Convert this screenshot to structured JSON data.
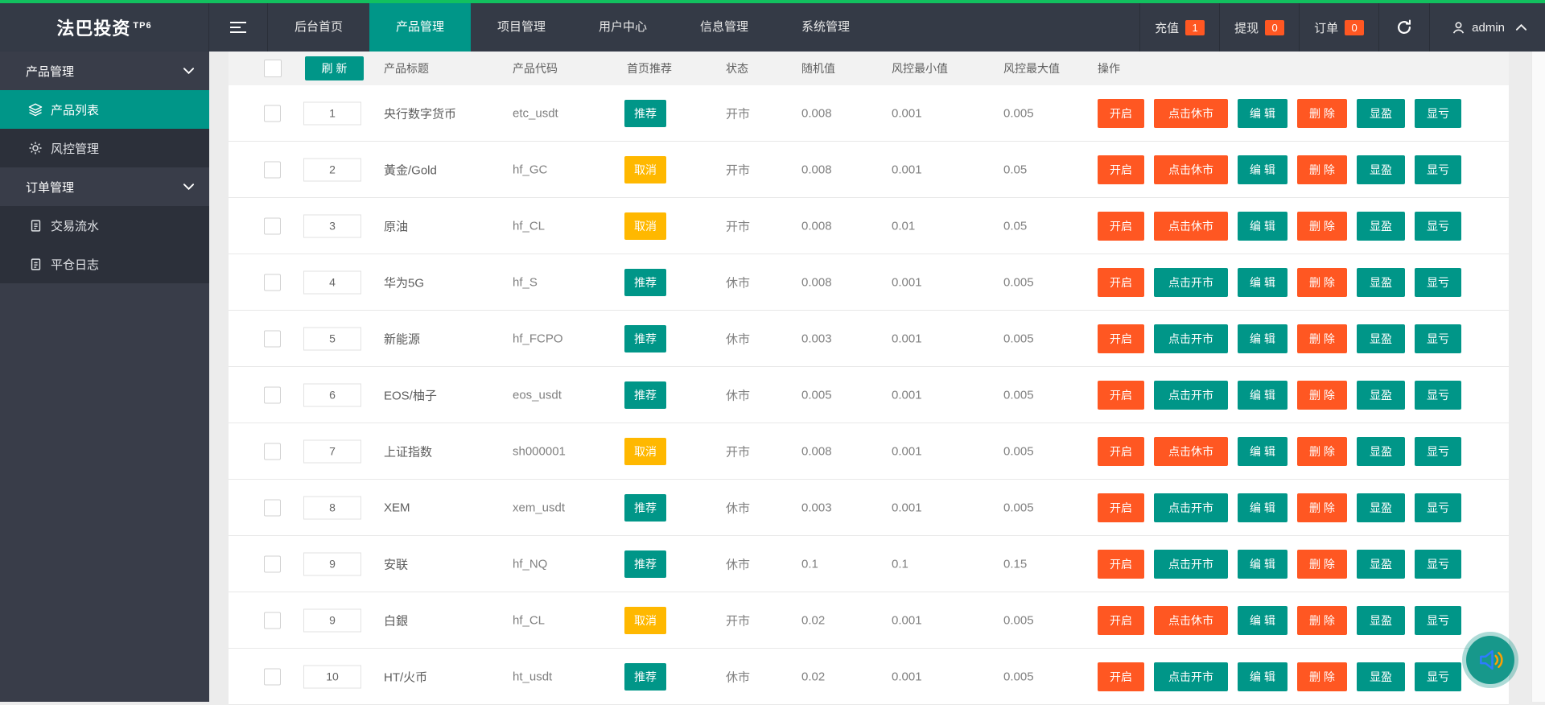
{
  "topbar": {
    "logo": "法巴投资",
    "logo_sup": "TP6",
    "nav": [
      {
        "label": "后台首页",
        "active": false
      },
      {
        "label": "产品管理",
        "active": true
      },
      {
        "label": "项目管理",
        "active": false
      },
      {
        "label": "用户中心",
        "active": false
      },
      {
        "label": "信息管理",
        "active": false
      },
      {
        "label": "系统管理",
        "active": false
      }
    ],
    "stats": [
      {
        "label": "充值",
        "count": "1"
      },
      {
        "label": "提现",
        "count": "0"
      },
      {
        "label": "订单",
        "count": "0"
      }
    ],
    "username": "admin"
  },
  "sidebar": {
    "groups": [
      {
        "label": "产品管理",
        "items": [
          {
            "label": "产品列表",
            "icon": "layers-icon",
            "active": true
          },
          {
            "label": "风控管理",
            "icon": "gear-icon",
            "active": false
          }
        ]
      },
      {
        "label": "订单管理",
        "items": [
          {
            "label": "交易流水",
            "icon": "document-icon",
            "active": false
          },
          {
            "label": "平仓日志",
            "icon": "document-icon",
            "active": false
          }
        ]
      }
    ]
  },
  "table": {
    "refresh_label": "刷 新",
    "headers": {
      "title": "产品标题",
      "code": "产品代码",
      "recommend": "首页推荐",
      "status": "状态",
      "random": "随机值",
      "risk_min": "风控最小值",
      "risk_max": "风控最大值",
      "actions": "操作"
    },
    "action_labels": {
      "open": "开启",
      "close_market": "点击休市",
      "open_market": "点击开市",
      "edit": "编 辑",
      "delete": "删 除",
      "show_win": "显盈",
      "show_loss": "显亏"
    },
    "recommend_labels": {
      "on": "推荐",
      "off": "取消"
    },
    "rows": [
      {
        "sort": "1",
        "title": "央行数字货币",
        "code": "etc_usdt",
        "recommend": "on",
        "status": "开市",
        "random": "0.008",
        "risk_min": "0.001",
        "risk_max": "0.005",
        "market": "open"
      },
      {
        "sort": "2",
        "title": "黃金/Gold",
        "code": "hf_GC",
        "recommend": "off",
        "status": "开市",
        "random": "0.008",
        "risk_min": "0.001",
        "risk_max": "0.05",
        "market": "open"
      },
      {
        "sort": "3",
        "title": "原油",
        "code": "hf_CL",
        "recommend": "off",
        "status": "开市",
        "random": "0.008",
        "risk_min": "0.01",
        "risk_max": "0.05",
        "market": "open"
      },
      {
        "sort": "4",
        "title": "华为5G",
        "code": "hf_S",
        "recommend": "on",
        "status": "休市",
        "random": "0.008",
        "risk_min": "0.001",
        "risk_max": "0.005",
        "market": "closed"
      },
      {
        "sort": "5",
        "title": "新能源",
        "code": "hf_FCPO",
        "recommend": "on",
        "status": "休市",
        "random": "0.003",
        "risk_min": "0.001",
        "risk_max": "0.005",
        "market": "closed"
      },
      {
        "sort": "6",
        "title": "EOS/柚子",
        "code": "eos_usdt",
        "recommend": "on",
        "status": "休市",
        "random": "0.005",
        "risk_min": "0.001",
        "risk_max": "0.005",
        "market": "closed"
      },
      {
        "sort": "7",
        "title": "上证指数",
        "code": "sh000001",
        "recommend": "off",
        "status": "开市",
        "random": "0.008",
        "risk_min": "0.001",
        "risk_max": "0.005",
        "market": "open"
      },
      {
        "sort": "8",
        "title": "XEM",
        "code": "xem_usdt",
        "recommend": "on",
        "status": "休市",
        "random": "0.003",
        "risk_min": "0.001",
        "risk_max": "0.005",
        "market": "closed"
      },
      {
        "sort": "9",
        "title": "安联",
        "code": "hf_NQ",
        "recommend": "on",
        "status": "休市",
        "random": "0.1",
        "risk_min": "0.1",
        "risk_max": "0.15",
        "market": "closed"
      },
      {
        "sort": "9",
        "title": "白銀",
        "code": "hf_CL",
        "recommend": "off",
        "status": "开市",
        "random": "0.02",
        "risk_min": "0.001",
        "risk_max": "0.005",
        "market": "open"
      },
      {
        "sort": "10",
        "title": "HT/火币",
        "code": "ht_usdt",
        "recommend": "on",
        "status": "休市",
        "random": "0.02",
        "risk_min": "0.001",
        "risk_max": "0.005",
        "market": "closed"
      }
    ]
  },
  "colors": {
    "teal": "#009688",
    "orange": "#ff5722",
    "yellow": "#ffb800",
    "top_green": "#12c05f",
    "dark": "#393d49"
  }
}
